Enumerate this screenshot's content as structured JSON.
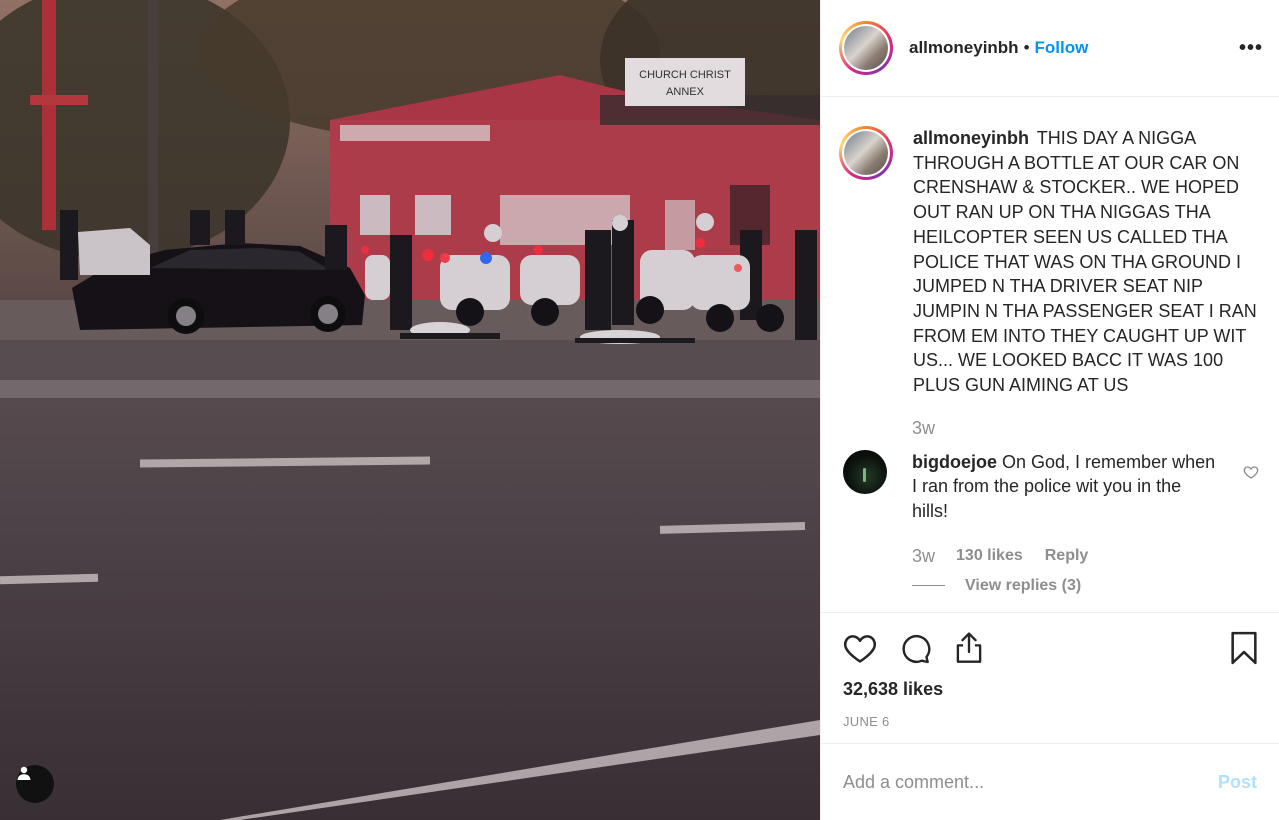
{
  "post": {
    "username": "allmoneyinbh",
    "dot": "•",
    "follow_label": "Follow",
    "more_label": "•••",
    "photo_sign_text_line1": "CHURCH CHRIST",
    "photo_sign_text_line2": "ANNEX",
    "caption": {
      "username": "allmoneyinbh",
      "text": "THIS DAY A NIGGA THROUGH A BOTTLE AT OUR CAR ON CRENSHAW & STOCKER.. WE HOPED OUT RAN UP ON THA NIGGAS THA HEILCOPTER SEEN US CALLED THA POLICE THAT WAS ON THA GROUND I JUMPED N THA DRIVER SEAT NIP JUMPIN N THA PASSENGER SEAT I RAN FROM EM INTO THEY CAUGHT UP WIT US... WE LOOKED BACC IT WAS 100 PLUS GUN AIMING AT US",
      "time": "3w"
    },
    "comments": [
      {
        "username": "bigdoejoe",
        "text": "On God, I remember when I ran from the police wit you in the hills!",
        "time": "3w",
        "likes": "130 likes",
        "reply_label": "Reply",
        "view_replies": "View replies (3)"
      }
    ],
    "like_count": "32,638 likes",
    "date": "JUNE 6",
    "add_comment_placeholder": "Add a comment...",
    "post_label": "Post"
  },
  "icons": {
    "like": "heart-icon",
    "comment": "comment-bubble-icon",
    "share": "share-icon",
    "save": "bookmark-icon",
    "tag": "user-tag-icon",
    "comment_like": "heart-outline-small-icon"
  },
  "colors": {
    "accent": "#0095f6",
    "muted": "#8e8e8e",
    "post_disabled": "#b2dffc",
    "text": "#262626"
  }
}
